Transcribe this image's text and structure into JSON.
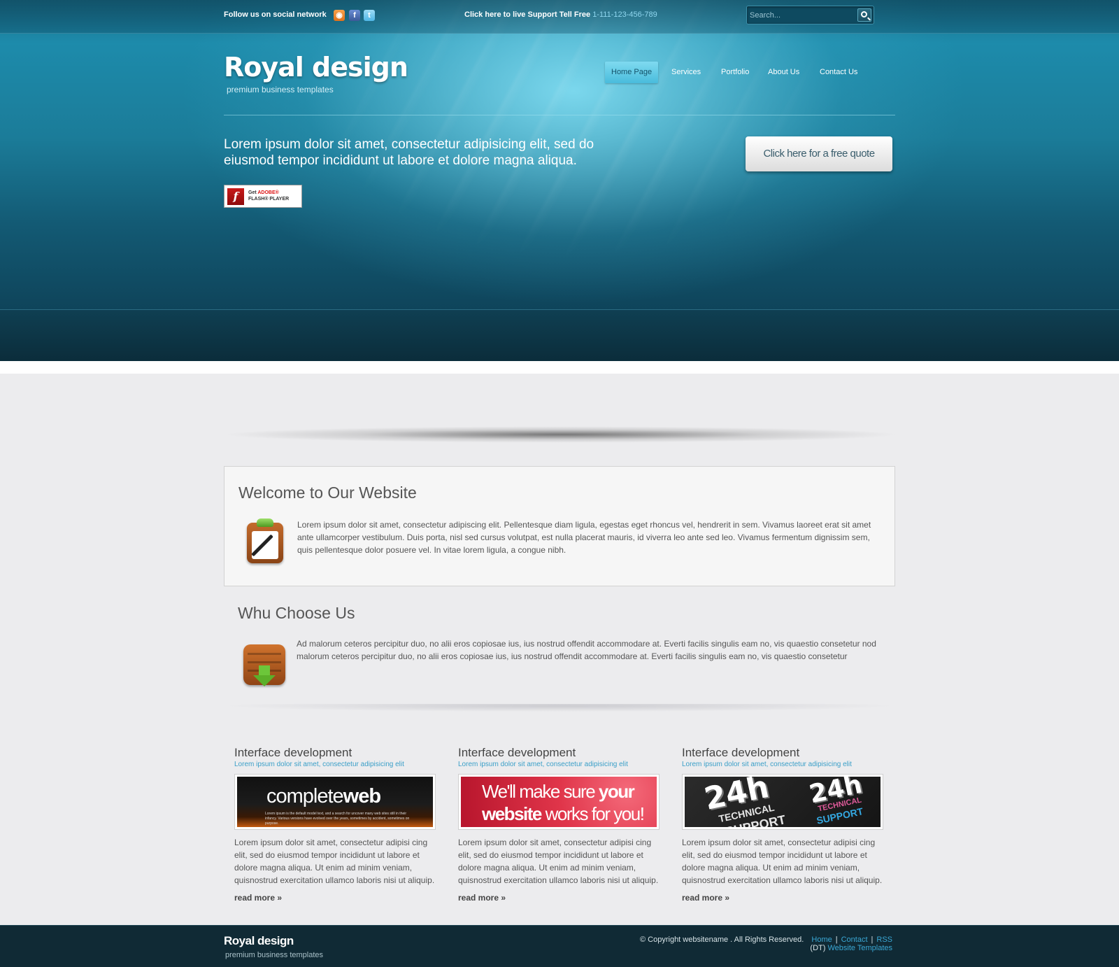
{
  "topbar": {
    "follow_label": "Follow us on social network",
    "social_icons": [
      "rss-icon",
      "facebook-icon",
      "twitter-icon"
    ],
    "support_label": "Click here to live Support Tell Free",
    "support_phone": "1-111-123-456-789",
    "search_placeholder": "Search..."
  },
  "brand": {
    "name": "Royal design",
    "tagline": "premium business templates"
  },
  "nav": {
    "items": [
      {
        "label": "Home Page",
        "active": true
      },
      {
        "label": "Services"
      },
      {
        "label": "Portfolio"
      },
      {
        "label": "About Us"
      },
      {
        "label": "Contact Us"
      }
    ]
  },
  "hero": {
    "intro": "Lorem ipsum dolor sit amet, consectetur adipisicing elit, sed do eiusmod tempor incididunt ut labore et dolore magna aliqua.",
    "quote_button": "Click here for a free quote",
    "flash": {
      "line1_prefix": "Get",
      "line1_brand": "ADOBE®",
      "line2": "FLASH® PLAYER"
    }
  },
  "welcome": {
    "title": "Welcome to Our Website",
    "text": "Lorem ipsum dolor sit amet, consectetur adipiscing elit. Pellentesque diam ligula, egestas eget rhoncus vel, hendrerit in sem. Vivamus laoreet erat sit amet ante ullamcorper vestibulum. Duis porta, nisl sed cursus volutpat, est nulla placerat mauris, id viverra leo ante sed leo. Vivamus fermentum dignissim sem, quis pellentesque dolor posuere vel. In vitae lorem ligula, a congue nibh."
  },
  "why": {
    "title": "Whu Choose Us",
    "text": "Ad malorum ceteros percipitur duo, no alii eros copiosae ius, ius nostrud offendit accommodare at. Everti facilis singulis eam no, vis quaestio consetetur nod malorum ceteros percipitur duo, no alii eros copiosae ius, ius nostrud offendit accommodare at. Everti facilis singulis eam no, vis quaestio consetetur"
  },
  "columns": [
    {
      "title": "Interface development",
      "subtitle": "Lorem ipsum dolor sit amet, consectetur adipisicing elit",
      "image": {
        "big_regular": "complete",
        "big_bold": "web",
        "small": "Lorem ipsum is the default model text, and a search for uncover many web sites still in their infancy. Various versions have evolved over the years, sometimes by accident, sometimes on purpose."
      },
      "text": "Lorem ipsum dolor sit amet, consectetur adipisi cing elit, sed do eiusmod tempor incididunt ut labore et dolore magna aliqua. Ut enim ad minim veniam, quisnostrud exercitation ullamco laboris nisi ut aliquip.",
      "read_more": "read more »"
    },
    {
      "title": "Interface development",
      "subtitle": "Lorem ipsum dolor sit amet, consectetur adipisicing elit",
      "image": {
        "l1_regular": "We'll make sure",
        "l1_bold": "your",
        "l2_bold": "website",
        "l2_regular": "works for you!"
      },
      "text": "Lorem ipsum dolor sit amet, consectetur adipisi cing elit, sed do eiusmod tempor incididunt ut labore et dolore magna aliqua. Ut enim ad minim veniam, quisnostrud exercitation ullamco laboris nisi ut aliquip.",
      "read_more": "read more »"
    },
    {
      "title": "Interface development",
      "subtitle": "Lorem ipsum dolor sit amet, consectetur adipisicing elit",
      "image": {
        "left_big": "24h",
        "left_small": "TECHNICAL",
        "left_small2": "SUPPORT",
        "right_big": "24h",
        "right_small": "TECHNICAL",
        "right_small2": "SUPPORT"
      },
      "text": "Lorem ipsum dolor sit amet, consectetur adipisi cing elit, sed do eiusmod tempor incididunt ut labore et dolore magna aliqua. Ut enim ad minim veniam, quisnostrud exercitation ullamco laboris nisi ut aliquip.",
      "read_more": "read more »"
    }
  ],
  "footer": {
    "name": "Royal design",
    "tagline": "premium business templates",
    "copyright": "© Copyright websitename . All Rights Reserved.",
    "links": [
      "Home",
      "Contact",
      "RSS"
    ],
    "credit_prefix": "(DT)",
    "credit_link": "Website Templates"
  },
  "colors": {
    "accent": "#3aa7d4",
    "nav_active": "#49bcdc",
    "header_dark": "#0e4258",
    "footer_bg": "#102a35"
  }
}
